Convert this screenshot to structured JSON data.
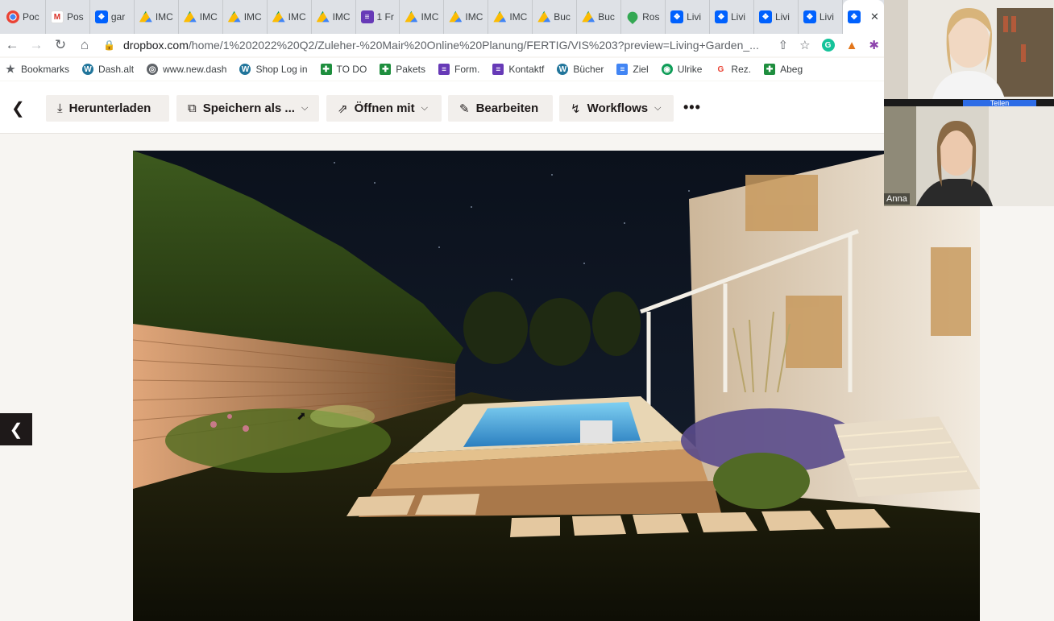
{
  "browser": {
    "tabs": [
      {
        "icon": "chrome-icon",
        "title": "Poc"
      },
      {
        "icon": "gmail-icon",
        "title": "Pos"
      },
      {
        "icon": "dropbox-icon",
        "title": "gar"
      },
      {
        "icon": "drive-icon",
        "title": "IMC"
      },
      {
        "icon": "drive-icon",
        "title": "IMC"
      },
      {
        "icon": "drive-icon",
        "title": "IMC"
      },
      {
        "icon": "drive-icon",
        "title": "IMC"
      },
      {
        "icon": "drive-icon",
        "title": "IMC"
      },
      {
        "icon": "forms-icon",
        "title": "1 Fr"
      },
      {
        "icon": "drive-icon",
        "title": "IMC"
      },
      {
        "icon": "drive-icon",
        "title": "IMC"
      },
      {
        "icon": "drive-icon",
        "title": "IMC"
      },
      {
        "icon": "drive-icon",
        "title": "Buc"
      },
      {
        "icon": "drive-icon",
        "title": "Buc"
      },
      {
        "icon": "maps-icon",
        "title": "Ros"
      },
      {
        "icon": "dropbox-icon",
        "title": "Livi"
      },
      {
        "icon": "dropbox-icon",
        "title": "Livi"
      },
      {
        "icon": "dropbox-icon",
        "title": "Livi"
      },
      {
        "icon": "dropbox-icon",
        "title": "Livi"
      }
    ],
    "url_host": "dropbox.com",
    "url_path": "/home/1%202022%20Q2/Zuleher-%20Mair%20Online%20Planung/FERTIG/VIS%203?preview=Living+Garden_...",
    "bookmarks": [
      {
        "icon": "star-icon",
        "label": "Bookmarks"
      },
      {
        "icon": "wordpress-icon",
        "label": "Dash.alt"
      },
      {
        "icon": "globe-icon",
        "label": "www.new.dash"
      },
      {
        "icon": "wordpress-icon",
        "label": "Shop Log in"
      },
      {
        "icon": "sheets-icon",
        "label": "TO DO"
      },
      {
        "icon": "sheets-icon",
        "label": "Pakets"
      },
      {
        "icon": "forms-icon",
        "label": "Form."
      },
      {
        "icon": "forms-icon",
        "label": "Kontaktf"
      },
      {
        "icon": "wordpress-icon",
        "label": "Bücher"
      },
      {
        "icon": "docs-icon",
        "label": "Ziel"
      },
      {
        "icon": "extension-icon",
        "label": "Ulrike"
      },
      {
        "icon": "google-icon",
        "label": "Rez."
      },
      {
        "icon": "sheets-icon",
        "label": "Abeg"
      }
    ]
  },
  "toolbar": {
    "download": "Herunterladen",
    "save_as": "Speichern als ...",
    "open_with": "Öffnen mit",
    "edit": "Bearbeiten",
    "workflows": "Workflows"
  },
  "video_call": {
    "participant_2_name": "Anna",
    "share_label": "Teilen"
  }
}
